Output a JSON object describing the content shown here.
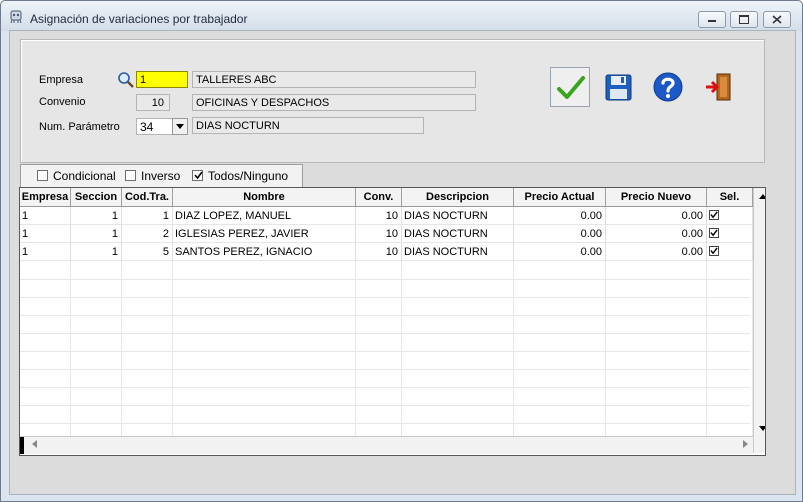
{
  "window": {
    "title": "Asignación de variaciones por trabajador"
  },
  "form": {
    "empresa_label": "Empresa",
    "empresa_code": "1",
    "empresa_name": "TALLERES ABC",
    "convenio_label": "Convenio",
    "convenio_code": "10",
    "convenio_name": "OFICINAS Y DESPACHOS",
    "parametro_label": "Num. Parámetro",
    "parametro_value": "34",
    "parametro_desc": "DIAS NOCTURN"
  },
  "toolbar": {
    "accept_icon": "checkmark-icon",
    "save_icon": "floppy-disk-icon",
    "help_icon": "help-icon",
    "exit_icon": "exit-door-icon"
  },
  "filters": [
    {
      "label": "Condicional",
      "checked": false
    },
    {
      "label": "Inverso",
      "checked": false
    },
    {
      "label": "Todos/Ninguno",
      "checked": true
    }
  ],
  "grid": {
    "columns": [
      "Empresa",
      "Seccion",
      "Cod.Tra.",
      "Nombre",
      "Conv.",
      "Descripcion",
      "Precio Actual",
      "Precio Nuevo",
      "Sel."
    ],
    "rows": [
      {
        "empresa": "1",
        "seccion": "1",
        "cod": "1",
        "nombre": "DIAZ  LOPEZ, MANUEL",
        "conv": "10",
        "descripcion": "DIAS NOCTURN",
        "precio_actual": "0.00",
        "precio_nuevo": "0.00",
        "sel": true
      },
      {
        "empresa": "1",
        "seccion": "1",
        "cod": "2",
        "nombre": "IGLESIAS PEREZ, JAVIER",
        "conv": "10",
        "descripcion": "DIAS NOCTURN",
        "precio_actual": "0.00",
        "precio_nuevo": "0.00",
        "sel": true
      },
      {
        "empresa": "1",
        "seccion": "1",
        "cod": "5",
        "nombre": "SANTOS PEREZ, IGNACIO",
        "conv": "10",
        "descripcion": "DIAS NOCTURN",
        "precio_actual": "0.00",
        "precio_nuevo": "0.00",
        "sel": true
      }
    ]
  }
}
